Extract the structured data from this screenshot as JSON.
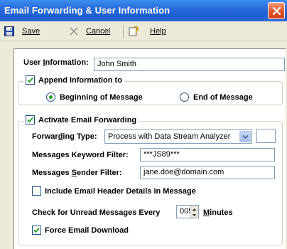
{
  "window": {
    "title": "Email Forwarding & User Information"
  },
  "toolbar": {
    "save": "Save",
    "cancel": "Cancel",
    "help": "Help"
  },
  "user_info": {
    "label_pre": "User ",
    "label_u": "I",
    "label_post": "nformation:",
    "value": "John Smith"
  },
  "append": {
    "checked": true,
    "label": "Append Information to",
    "option_beginning": "Beginning of Message",
    "option_end": "End of Message",
    "selected": "beginning"
  },
  "forwarding": {
    "checked": true,
    "label": "Activate Email Forwarding",
    "type_label_pre": "Forwar",
    "type_label_u": "d",
    "type_label_post": "ing Type:",
    "type_value": "Process with Data Stream Analyzer",
    "keyword_label": "Messages Keyword Filter:",
    "keyword_value": "***JS89***",
    "sender_label_pre": "Messages ",
    "sender_label_u": "S",
    "sender_label_post": "ender Filter:",
    "sender_value": "jane.doe@domain.com",
    "include_header_checked": false,
    "include_header_label": "Include Email Header Details in Message",
    "unread_label": "Check for Unread Messages Every",
    "unread_value": "005",
    "minutes_label_u": "M",
    "minutes_label_post": "inutes",
    "force_download_checked": true,
    "force_download_label": "Force Email Download"
  },
  "colors": {
    "titlebar": "#2b6fdd",
    "close": "#e25a2d",
    "window_bg": "#ece9d8",
    "checkmark": "#21a121",
    "input_border": "#7f9db9"
  }
}
